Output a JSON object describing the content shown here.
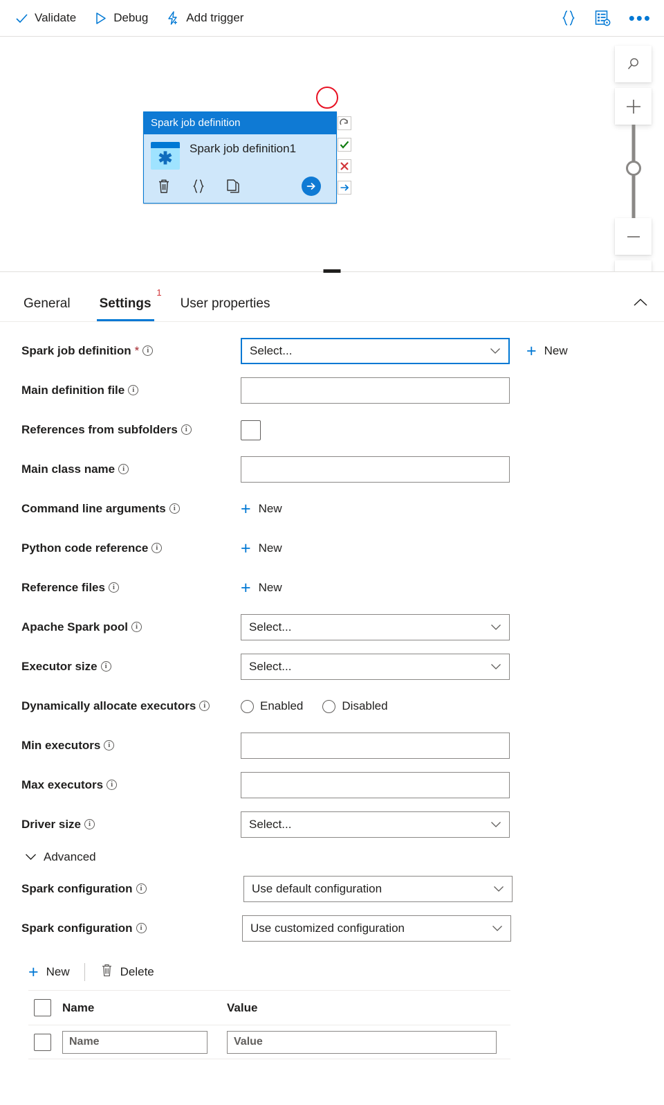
{
  "toolbar": {
    "items": [
      {
        "label": "Validate",
        "icon": "check-icon"
      },
      {
        "label": "Debug",
        "icon": "play-icon"
      },
      {
        "label": "Add trigger",
        "icon": "lightning-plus-icon"
      }
    ],
    "right_icons": [
      {
        "name": "code-braces-icon",
        "glyph": "{ }"
      },
      {
        "name": "properties-gear-icon",
        "glyph": ""
      },
      {
        "name": "more-ellipsis-icon",
        "glyph": "•••"
      }
    ]
  },
  "canvas": {
    "node": {
      "header": "Spark job definition",
      "title": "Spark job definition1",
      "icon": "spark-job-definition-icon",
      "glyph": "✱",
      "tools": [
        {
          "name": "delete-activity-icon",
          "label": "Delete"
        },
        {
          "name": "code-braces-icon",
          "label": "Code"
        },
        {
          "name": "clone-activity-icon",
          "label": "Clone"
        },
        {
          "name": "run-activity-button",
          "label": "Run"
        }
      ]
    },
    "dependencies": [
      {
        "name": "dependency-skipped",
        "glyph": "↷",
        "color": "#605e5c"
      },
      {
        "name": "dependency-success",
        "glyph": "✔",
        "color": "#107c10"
      },
      {
        "name": "dependency-failure",
        "glyph": "✖",
        "color": "#d13438"
      },
      {
        "name": "dependency-completion",
        "glyph": "→",
        "color": "#0078d4"
      }
    ],
    "zoom_controls": [
      {
        "name": "search-canvas-icon"
      },
      {
        "name": "zoom-in-icon"
      },
      {
        "name": "zoom-slider"
      },
      {
        "name": "zoom-out-icon"
      },
      {
        "name": "fit-to-screen-icon"
      }
    ]
  },
  "panel": {
    "tabs": [
      {
        "label": "General",
        "active": false,
        "badge": ""
      },
      {
        "label": "Settings",
        "active": true,
        "badge": "1"
      },
      {
        "label": "User properties",
        "active": false,
        "badge": ""
      }
    ],
    "collapse_icon": "chevron-up-icon"
  },
  "settings": {
    "spark_job_definition": {
      "label": "Spark job definition",
      "required": "*",
      "value": "Select...",
      "new_label": "New"
    },
    "main_definition_file": {
      "label": "Main definition file",
      "value": ""
    },
    "references_from_subfolders": {
      "label": "References from subfolders",
      "checked": false
    },
    "main_class_name": {
      "label": "Main class name",
      "value": ""
    },
    "command_line_arguments": {
      "label": "Command line arguments",
      "new_label": "New"
    },
    "python_code_reference": {
      "label": "Python code reference",
      "new_label": "New"
    },
    "reference_files": {
      "label": "Reference files",
      "new_label": "New"
    },
    "apache_spark_pool": {
      "label": "Apache Spark pool",
      "value": "Select..."
    },
    "executor_size": {
      "label": "Executor size",
      "value": "Select..."
    },
    "dynamically_allocate_executors": {
      "label": "Dynamically allocate executors",
      "options": [
        "Enabled",
        "Disabled"
      ],
      "selected": ""
    },
    "min_executors": {
      "label": "Min executors",
      "value": ""
    },
    "max_executors": {
      "label": "Max executors",
      "value": ""
    },
    "driver_size": {
      "label": "Driver size",
      "value": "Select..."
    },
    "advanced": {
      "label": "Advanced",
      "expanded": true
    },
    "spark_configuration_default": {
      "label": "Spark configuration",
      "value": "Use default configuration"
    },
    "spark_configuration_custom": {
      "label": "Spark configuration",
      "value": "Use customized configuration"
    },
    "config_table": {
      "new_label": "New",
      "delete_label": "Delete",
      "columns": [
        "Name",
        "Value"
      ],
      "rows": [
        {
          "name_placeholder": "Name",
          "value_placeholder": "Value",
          "name": "",
          "value": ""
        }
      ]
    }
  },
  "colors": {
    "accent": "#0078d4",
    "node_header": "#0f7ad4",
    "node_body": "#cfe7fa",
    "required_red": "#a4262c",
    "badge_red": "#d13438",
    "success_green": "#107c10",
    "annotation_red": "#e81123"
  }
}
